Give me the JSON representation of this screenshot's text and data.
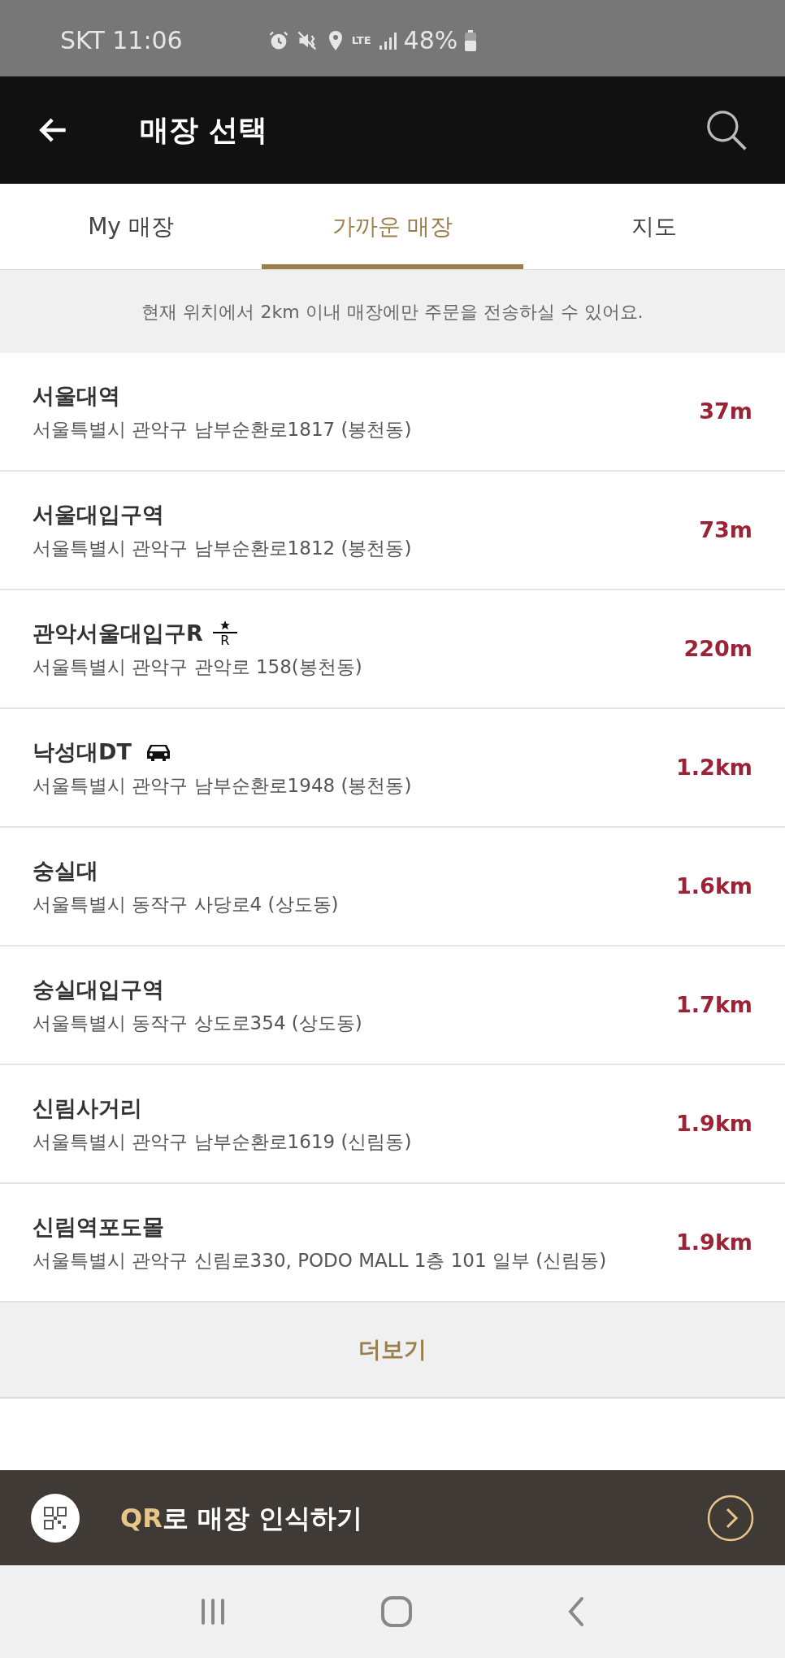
{
  "status_bar": {
    "carrier_time": "SKT 11:06",
    "network": "LTE",
    "battery": "48%"
  },
  "header": {
    "title": "매장 선택"
  },
  "tabs": [
    {
      "label": "My 매장",
      "selected": false
    },
    {
      "label": "가까운 매장",
      "selected": true
    },
    {
      "label": "지도",
      "selected": false
    }
  ],
  "notice": "현재 위치에서 2km 이내 매장에만 주문을 전송하실 수 있어요.",
  "stores": [
    {
      "name": "서울대역",
      "kind": "plain",
      "address": "서울특별시 관악구 남부순환로1817 (봉천동)",
      "distance": "37m"
    },
    {
      "name": "서울대입구역",
      "kind": "plain",
      "address": "서울특별시 관악구 남부순환로1812 (봉천동)",
      "distance": "73m"
    },
    {
      "name": "관악서울대입구R",
      "kind": "reserve",
      "badge": "R",
      "address": "서울특별시 관악구 관악로 158(봉천동)",
      "distance": "220m"
    },
    {
      "name": "낙성대DT",
      "kind": "drive_thru",
      "address": "서울특별시 관악구 남부순환로1948 (봉천동)",
      "distance": "1.2km"
    },
    {
      "name": "숭실대",
      "kind": "plain",
      "address": "서울특별시 동작구 사당로4 (상도동)",
      "distance": "1.6km"
    },
    {
      "name": "숭실대입구역",
      "kind": "plain",
      "address": "서울특별시 동작구 상도로354 (상도동)",
      "distance": "1.7km"
    },
    {
      "name": "신림사거리",
      "kind": "plain",
      "address": "서울특별시 관악구 남부순환로1619 (신림동)",
      "distance": "1.9km"
    },
    {
      "name": "신림역포도몰",
      "kind": "plain",
      "address": "서울특별시 관악구 신림로330, PODO MALL 1층 101 일부 (신림동)",
      "distance": "1.9km"
    }
  ],
  "more_button": "더보기",
  "qr_bar": {
    "highlight": "QR",
    "rest": "로 매장 인식하기"
  }
}
